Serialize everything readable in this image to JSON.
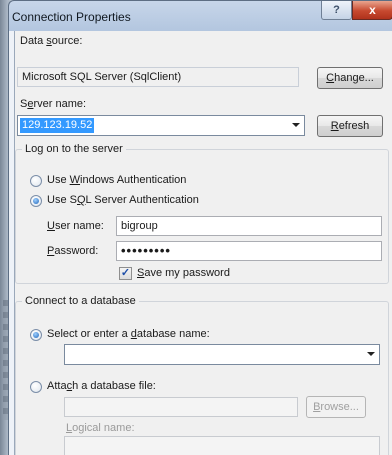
{
  "window": {
    "title": "Connection Properties",
    "help_glyph": "?",
    "close_glyph": "x"
  },
  "data_source": {
    "label_pre": "Data ",
    "label_key": "s",
    "label_post": "ource:",
    "value": "Microsoft SQL Server (SqlClient)",
    "change_pre": "",
    "change_key": "C",
    "change_post": "hange..."
  },
  "server": {
    "label_pre": "S",
    "label_key": "e",
    "label_post": "rver name:",
    "value": "129.123.19.52",
    "refresh_pre": "",
    "refresh_key": "R",
    "refresh_post": "efresh"
  },
  "logon": {
    "group_title": "Log on to the server",
    "windows_auth_pre": "Use ",
    "windows_auth_key": "W",
    "windows_auth_post": "indows Authentication",
    "sql_auth_pre": "Use S",
    "sql_auth_key": "Q",
    "sql_auth_post": "L Server Authentication",
    "username_key": "U",
    "username_post": "ser name:",
    "username_value": "bigroup",
    "password_key": "P",
    "password_post": "assword:",
    "password_value": "•••••••••",
    "save_password_pre": "",
    "save_password_key": "S",
    "save_password_post": "ave my password",
    "check_glyph": "✓"
  },
  "database": {
    "group_title": "Connect to a database",
    "select_pre": "Select or enter a ",
    "select_key": "d",
    "select_post": "atabase name:",
    "select_value": "",
    "attach_pre": "Atta",
    "attach_key": "c",
    "attach_post": "h a database file:",
    "attach_value": "",
    "browse_pre": "",
    "browse_key": "B",
    "browse_post": "rowse...",
    "logical_pre": "",
    "logical_key": "L",
    "logical_post": "ogical name:",
    "logical_value": ""
  }
}
